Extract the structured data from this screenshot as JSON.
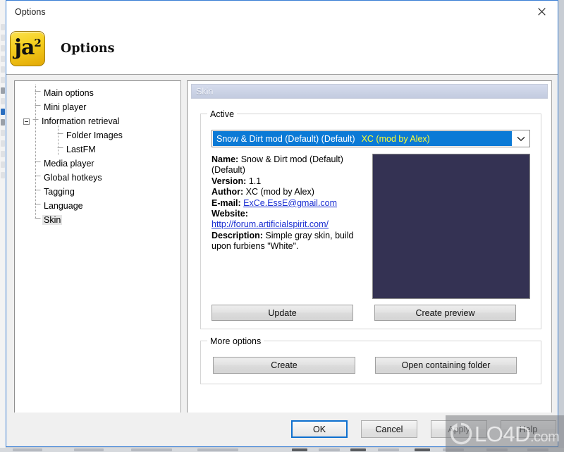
{
  "window": {
    "title": "Options",
    "close_icon": "close-x-icon"
  },
  "header": {
    "app_icon_label": "ja",
    "app_icon_superscript": "2",
    "heading": "Options"
  },
  "sidebar": {
    "items": [
      {
        "label": "Main options",
        "level": 1,
        "expander": false,
        "selected": false
      },
      {
        "label": "Mini player",
        "level": 1,
        "expander": false,
        "selected": false
      },
      {
        "label": "Information retrieval",
        "level": 1,
        "expander": true,
        "selected": false
      },
      {
        "label": "Folder Images",
        "level": 2,
        "expander": false,
        "selected": false
      },
      {
        "label": "LastFM",
        "level": 2,
        "expander": false,
        "selected": false
      },
      {
        "label": "Media player",
        "level": 1,
        "expander": false,
        "selected": false
      },
      {
        "label": "Global hotkeys",
        "level": 1,
        "expander": false,
        "selected": false
      },
      {
        "label": "Tagging",
        "level": 1,
        "expander": false,
        "selected": false
      },
      {
        "label": "Language",
        "level": 1,
        "expander": false,
        "selected": false
      },
      {
        "label": "Skin",
        "level": 1,
        "expander": false,
        "selected": true
      }
    ]
  },
  "panel": {
    "header_title": "Skin",
    "active_group": {
      "legend": "Active",
      "combo": {
        "name": "Snow & Dirt mod (Default) (Default)",
        "author": "XC (mod by Alex)",
        "arrow_icon": "chevron-down-icon"
      },
      "details": {
        "name_label": "Name:",
        "name_value": "Snow & Dirt mod (Default) (Default)",
        "version_label": "Version:",
        "version_value": "1.1",
        "author_label": "Author:",
        "author_value": "XC (mod by Alex)",
        "email_label": "E-mail:",
        "email_value": "ExCe.EssE@gmail.com",
        "website_label": "Website:",
        "website_value": "http://forum.artificialspirit.com/",
        "description_label": "Description:",
        "description_value": "Simple gray skin, build upon furbiens \"White\"."
      },
      "preview": {
        "name": "skin-preview",
        "color": "#343253"
      },
      "buttons": {
        "update": "Update",
        "create_preview": "Create preview"
      }
    },
    "more_group": {
      "legend": "More options",
      "buttons": {
        "create": "Create",
        "open_containing_folder": "Open containing folder"
      }
    }
  },
  "footer": {
    "ok": "OK",
    "cancel": "Cancel",
    "apply": "Apply",
    "help": "Help"
  },
  "watermark": {
    "text": "LO4D",
    "suffix": ".com",
    "logo_icon": "refresh-circle-arrow-icon"
  },
  "colors": {
    "accent_blue": "#0b7ad6",
    "combo_author_yellow": "#ffff2e",
    "link_blue": "#1a2ed2",
    "preview_navy": "#343253",
    "window_border": "#3a7fd5"
  }
}
